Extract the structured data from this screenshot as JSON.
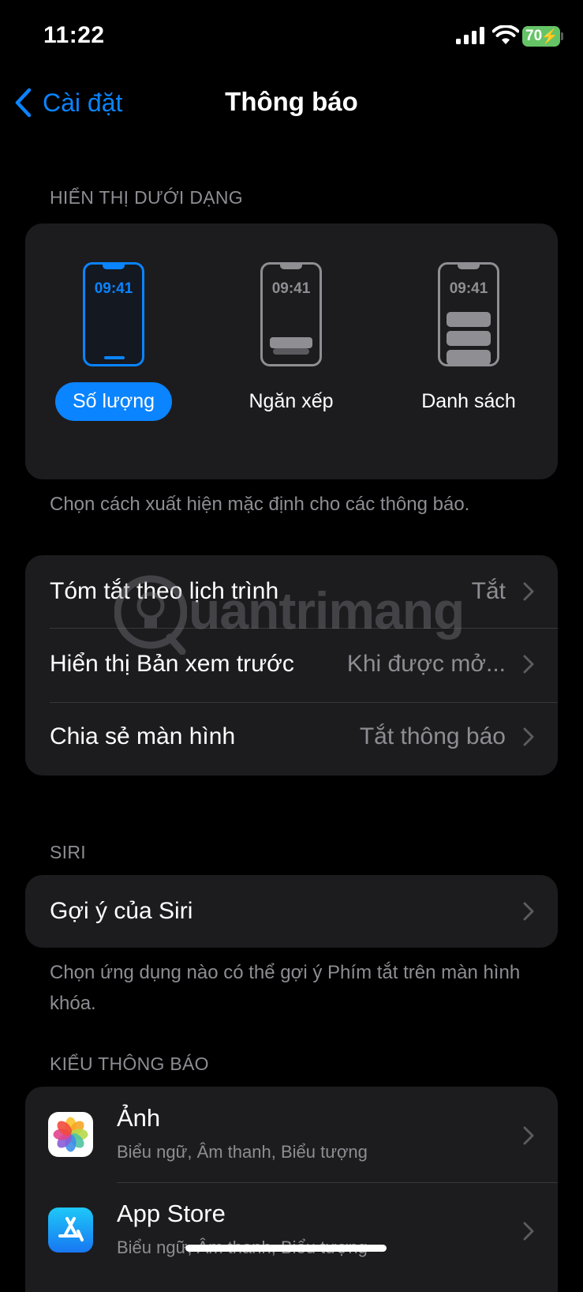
{
  "status_bar": {
    "time": "11:22",
    "battery": "70"
  },
  "nav": {
    "back_label": "Cài đặt",
    "title": "Thông báo"
  },
  "display_as": {
    "header": "HIỂN THỊ DƯỚI DẠNG",
    "phone_time": "09:41",
    "options": [
      {
        "label": "Số lượng",
        "selected": true
      },
      {
        "label": "Ngăn xếp",
        "selected": false
      },
      {
        "label": "Danh sách",
        "selected": false
      }
    ],
    "footer": "Chọn cách xuất hiện mặc định cho các thông báo."
  },
  "settings_rows": [
    {
      "label": "Tóm tắt theo lịch trình",
      "value": "Tắt"
    },
    {
      "label": "Hiển thị Bản xem trước",
      "value": "Khi được mở..."
    },
    {
      "label": "Chia sẻ màn hình",
      "value": "Tắt thông báo"
    }
  ],
  "siri": {
    "header": "SIRI",
    "row_label": "Gợi ý của Siri",
    "footer": "Chọn ứng dụng nào có thể gợi ý Phím tắt trên màn hình khóa."
  },
  "notification_style": {
    "header": "KIỂU THÔNG BÁO",
    "apps": [
      {
        "name": "Ảnh",
        "subtitle": "Biểu ngữ, Âm thanh, Biểu tượng",
        "icon": "photos-icon"
      },
      {
        "name": "App Store",
        "subtitle": "Biểu ngữ, Âm thanh, Biểu tượng",
        "icon": "app-store-icon"
      }
    ]
  },
  "watermark": "uantrimang",
  "colors": {
    "accent": "#0a84ff",
    "card": "#1c1c1e",
    "secondary_text": "#8d8d93"
  }
}
